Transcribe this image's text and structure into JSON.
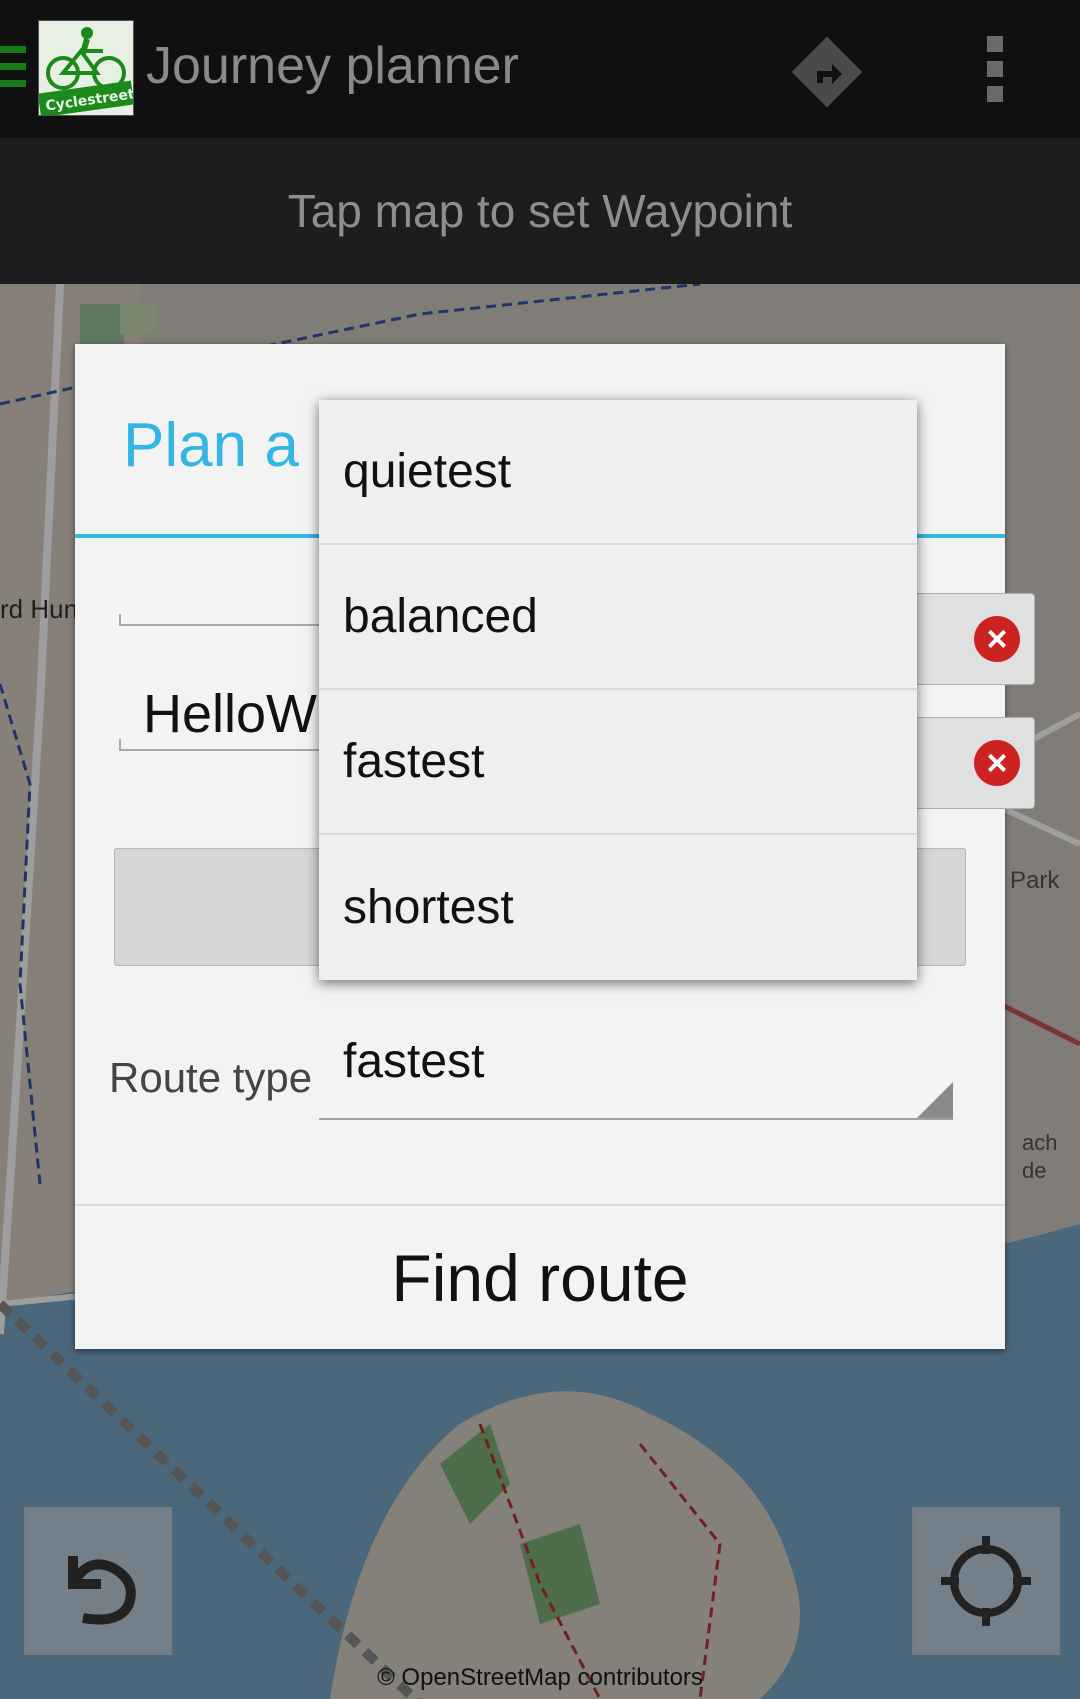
{
  "actionbar": {
    "title": "Journey planner",
    "logo_text": "Cyclestreets",
    "icons": [
      "drawer-indicator-icon",
      "cyclestreets-logo",
      "route-diamond-icon",
      "overflow-menu-icon"
    ]
  },
  "hint": {
    "text": "Tap map to set Waypoint"
  },
  "dialog": {
    "title": "Plan a",
    "start_value": "",
    "finish_value": "HelloW",
    "route_type_label": "Route type",
    "route_type_value": "fastest",
    "find_route_label": "Find route"
  },
  "dropdown": {
    "options": [
      "quietest",
      "balanced",
      "fastest",
      "shortest"
    ]
  },
  "map": {
    "attribution": "© OpenStreetMap contributors",
    "labels": [
      "rd Hun",
      "Park",
      "ach",
      "de"
    ]
  },
  "colors": {
    "accent": "#33b5e5",
    "water": "#7aa6c8",
    "land": "#cfc8c0"
  }
}
